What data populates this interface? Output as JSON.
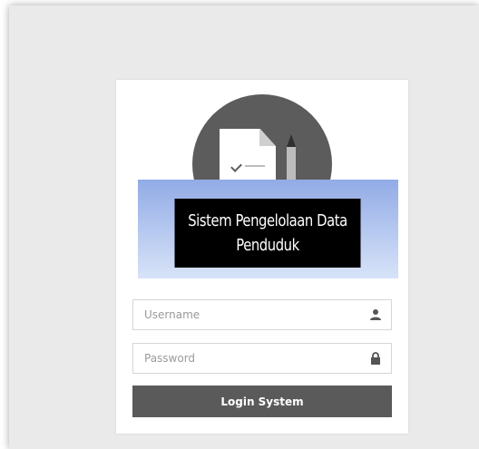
{
  "app": {
    "title_banner": "Sistem Pengelolaan Data Penduduk"
  },
  "logo": {
    "icon": "document-checklist-pencil-icon",
    "circle_color": "#5c5c5c"
  },
  "form": {
    "username": {
      "placeholder": "Username",
      "value": "",
      "icon": "user-icon"
    },
    "password": {
      "placeholder": "Password",
      "value": "",
      "icon": "lock-icon"
    },
    "submit_label": "Login System"
  },
  "colors": {
    "banner_gradient_top": "#92abe6",
    "banner_gradient_bottom": "#d7e3f8",
    "button": "#5a5a5a"
  }
}
